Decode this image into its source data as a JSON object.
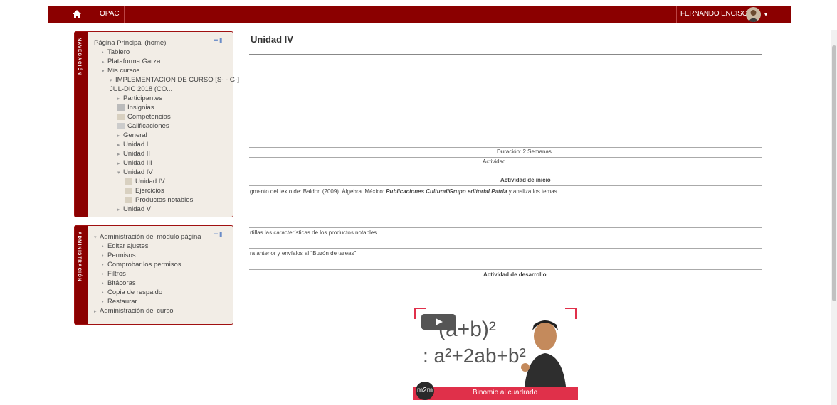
{
  "topbar": {
    "opac": "OPAC",
    "user": "FERNANDO ENCISO",
    "caret": "▾"
  },
  "nav_block": {
    "rail_label": "NAVEGACIÓN",
    "items": [
      {
        "label": "Página Principal (home)",
        "level": 0,
        "bullet": ""
      },
      {
        "label": "Tablero",
        "level": 1,
        "bullet": "•"
      },
      {
        "label": "Plataforma Garza",
        "level": 1,
        "bullet": "▸"
      },
      {
        "label": "Mis cursos",
        "level": 1,
        "bullet": "▾"
      },
      {
        "label": "IMPLEMENTACION DE CURSO [S- - G-]",
        "level": 2,
        "bullet": "▾"
      },
      {
        "label": "JUL-DIC 2018 (CO...",
        "level": 2,
        "bullet": ""
      },
      {
        "label": "Participantes",
        "level": 3,
        "bullet": "▸"
      },
      {
        "label": "Insignias",
        "level": 3,
        "bullet": "icon"
      },
      {
        "label": "Competencias",
        "level": 3,
        "bullet": "icon"
      },
      {
        "label": "Calificaciones",
        "level": 3,
        "bullet": "icon"
      },
      {
        "label": "General",
        "level": 3,
        "bullet": "▸"
      },
      {
        "label": "Unidad I",
        "level": 3,
        "bullet": "▸"
      },
      {
        "label": "Unidad II",
        "level": 3,
        "bullet": "▸"
      },
      {
        "label": "Unidad III",
        "level": 3,
        "bullet": "▸"
      },
      {
        "label": "Unidad IV",
        "level": 3,
        "bullet": "▾"
      },
      {
        "label": "Unidad IV",
        "level": 4,
        "bullet": "icon"
      },
      {
        "label": "Ejercicios",
        "level": 4,
        "bullet": "icon"
      },
      {
        "label": "Productos notables",
        "level": 4,
        "bullet": "icon"
      },
      {
        "label": "Unidad V",
        "level": 3,
        "bullet": "▸"
      }
    ]
  },
  "admin_block": {
    "rail_label": "ADMINISTRACIÓN",
    "items": [
      {
        "label": "Administración del módulo página",
        "level": 0,
        "bullet": "▾"
      },
      {
        "label": "Editar ajustes",
        "level": 1,
        "bullet": "•"
      },
      {
        "label": "Permisos",
        "level": 1,
        "bullet": "•"
      },
      {
        "label": "Comprobar los permisos",
        "level": 1,
        "bullet": "•"
      },
      {
        "label": "Filtros",
        "level": 1,
        "bullet": "•"
      },
      {
        "label": "Bitácoras",
        "level": 1,
        "bullet": "•"
      },
      {
        "label": "Copia de respaldo",
        "level": 1,
        "bullet": "•"
      },
      {
        "label": "Restaurar",
        "level": 1,
        "bullet": "•"
      },
      {
        "label": "Administración del curso",
        "level": 0,
        "bullet": "▸"
      }
    ]
  },
  "main": {
    "title": "Unidad IV",
    "duracion": "Duración: 2 Semanas",
    "actividad": "Actividad",
    "actividad_inicio": "Actividad de inicio",
    "texto_prefix": "gmento del texto de: Baldor. (2009). Álgebra. México: ",
    "texto_italic": "Publicaciones Cultural/Grupo editorial Patria",
    "texto_suffix": " y analiza los temas",
    "linea_2": "rtillas las características de los productos notables",
    "linea_3": "ra anterior y envíalos al \"Buzón de tareas\"",
    "actividad_desarrollo": "Actividad de desarrollo"
  },
  "video": {
    "formula_top": "(a+b)²",
    "formula_bottom": ": a²+2ab+b²",
    "caption": "Binomio al cuadrado",
    "logo": "m2m"
  }
}
